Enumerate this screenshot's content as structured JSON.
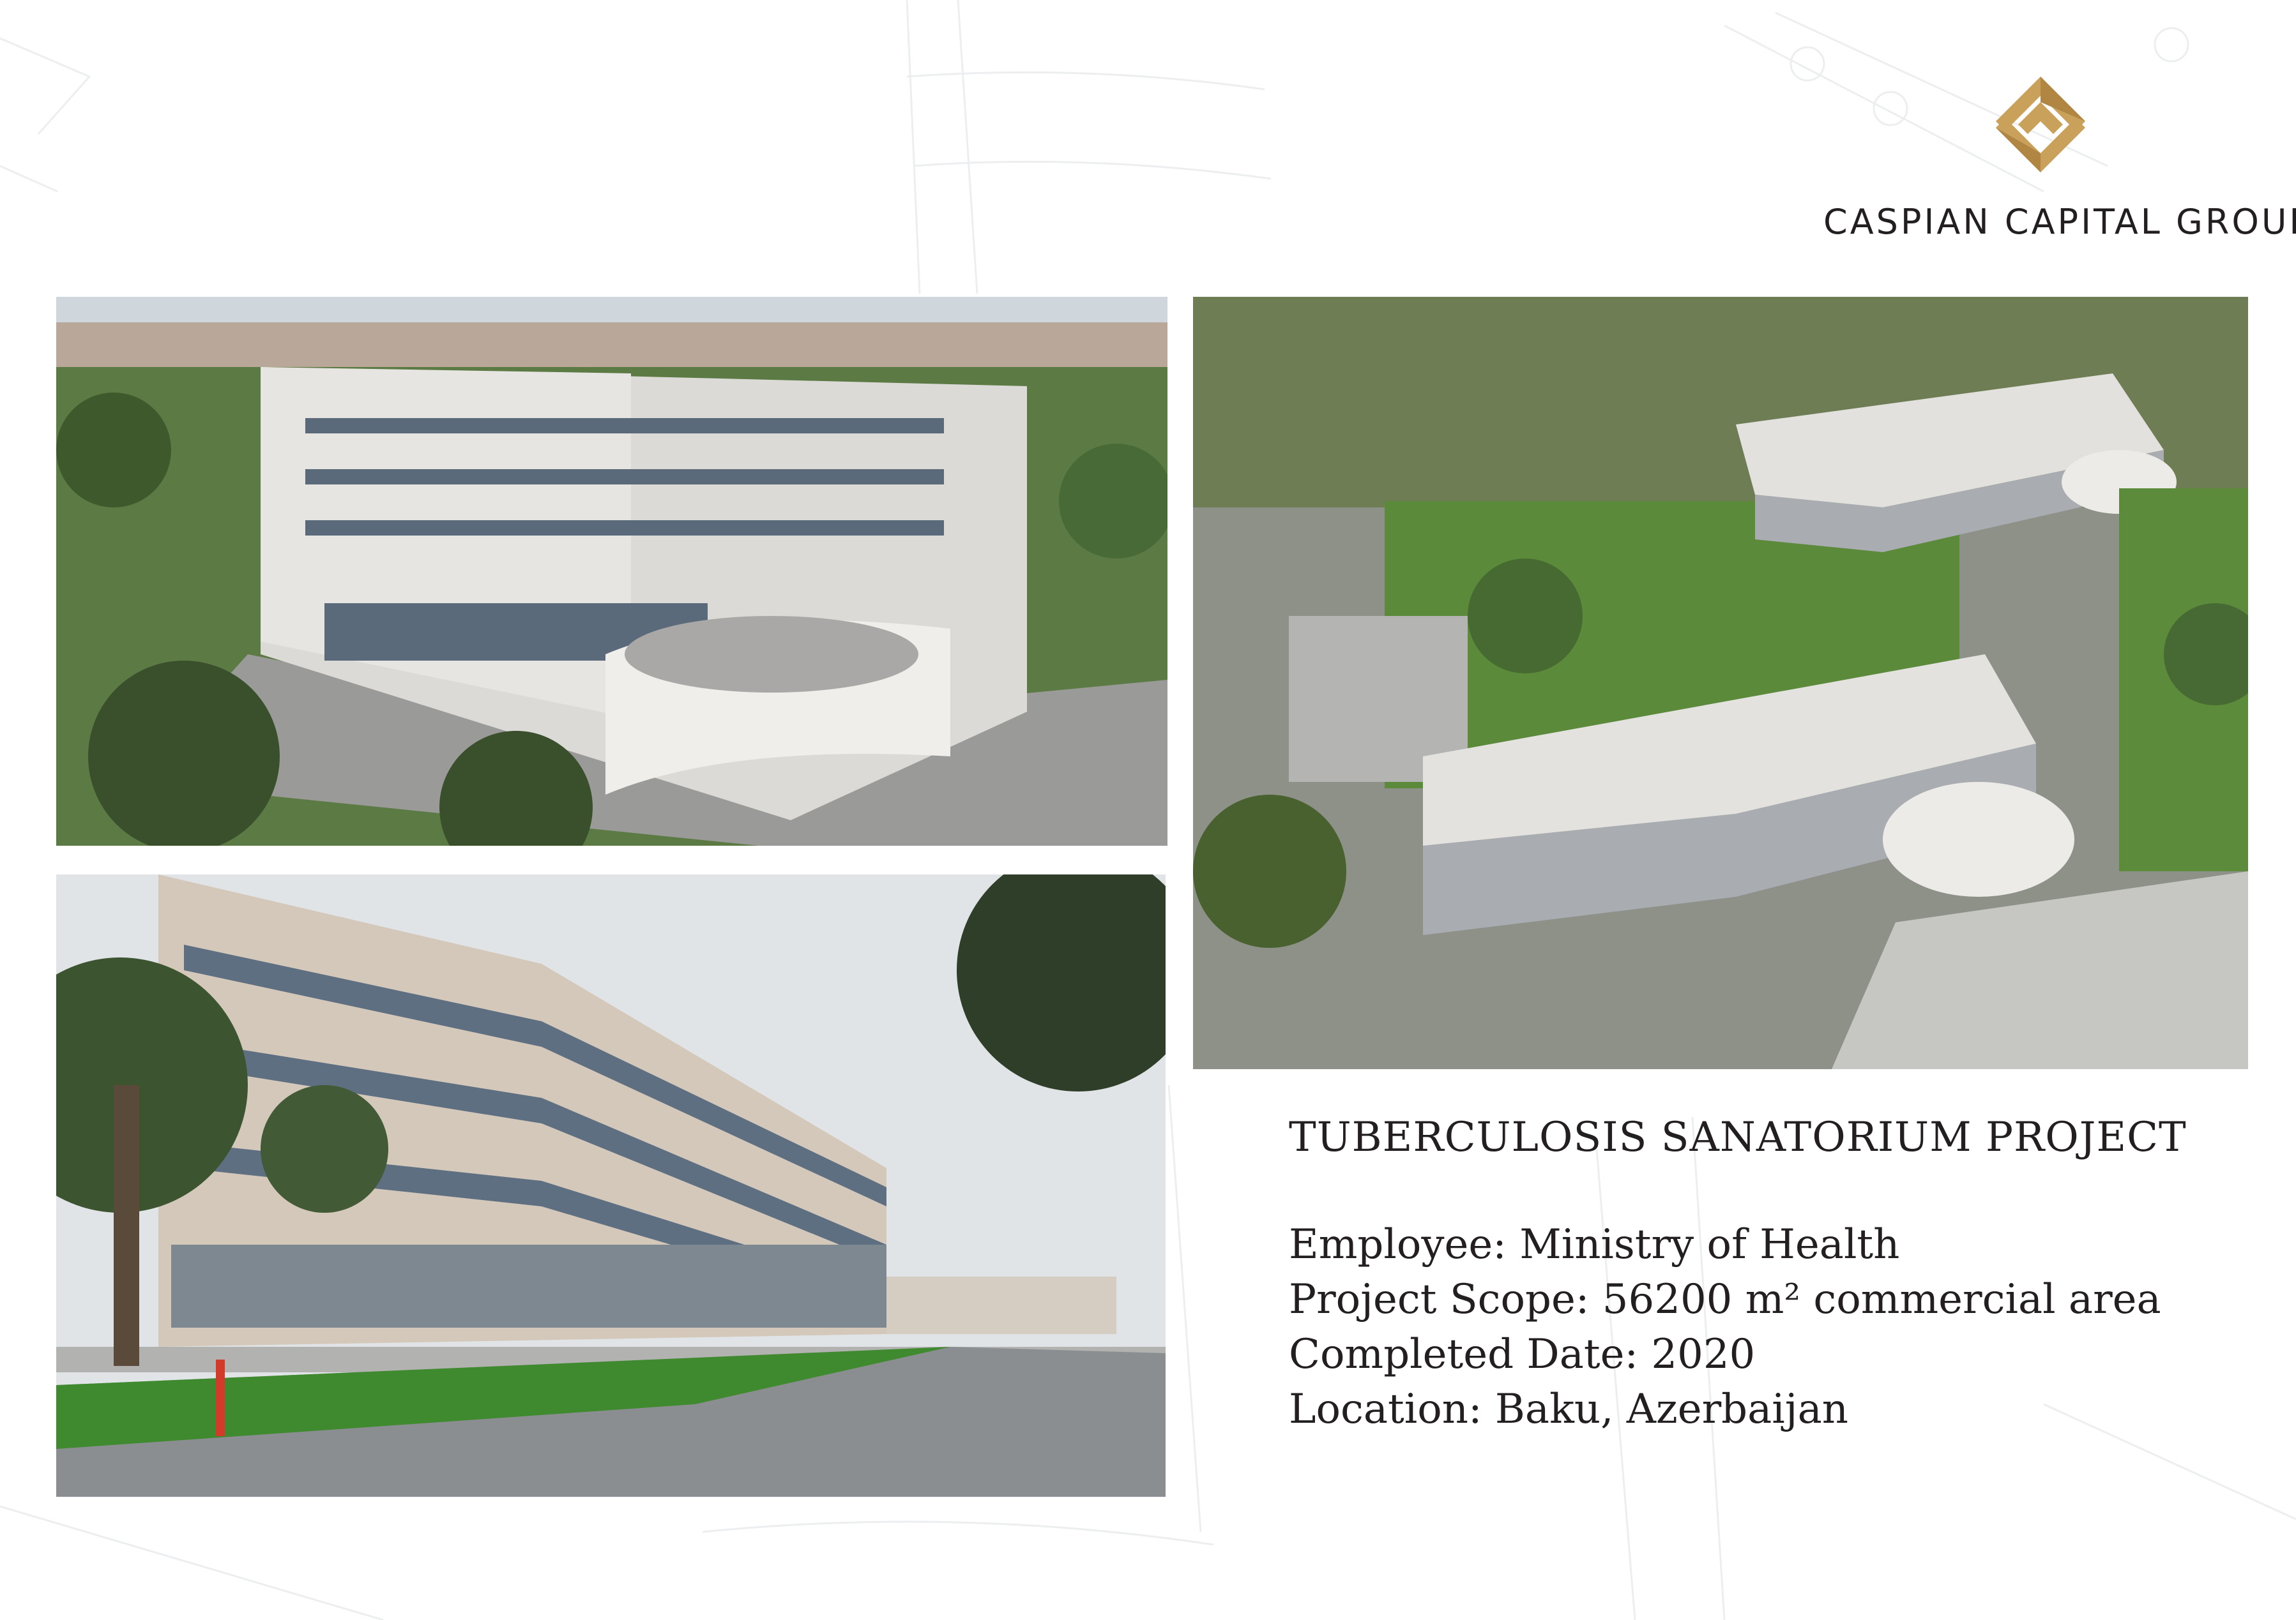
{
  "brand": {
    "name": "CASPIAN CAPITAL GROUP",
    "logo_icon": "caspian-diamond-logo",
    "colors": {
      "gold": "#c9a15a",
      "text": "#231f20",
      "background": "#ffffff"
    }
  },
  "photos": [
    {
      "label": "aerial-view-front",
      "alt": "Aerial view of sanatorium building"
    },
    {
      "label": "aerial-view-campus",
      "alt": "Overhead view of campus with two buildings"
    },
    {
      "label": "street-level-view",
      "alt": "Street level view of facade"
    }
  ],
  "project": {
    "title": "TUBERCULOSIS SANATORIUM PROJECT",
    "employee": "Employee: Ministry of Health",
    "scope": "Project Scope: 56200 m² commercial area",
    "completed": "Completed Date: 2020",
    "location": "Location: Baku, Azerbaijan"
  }
}
